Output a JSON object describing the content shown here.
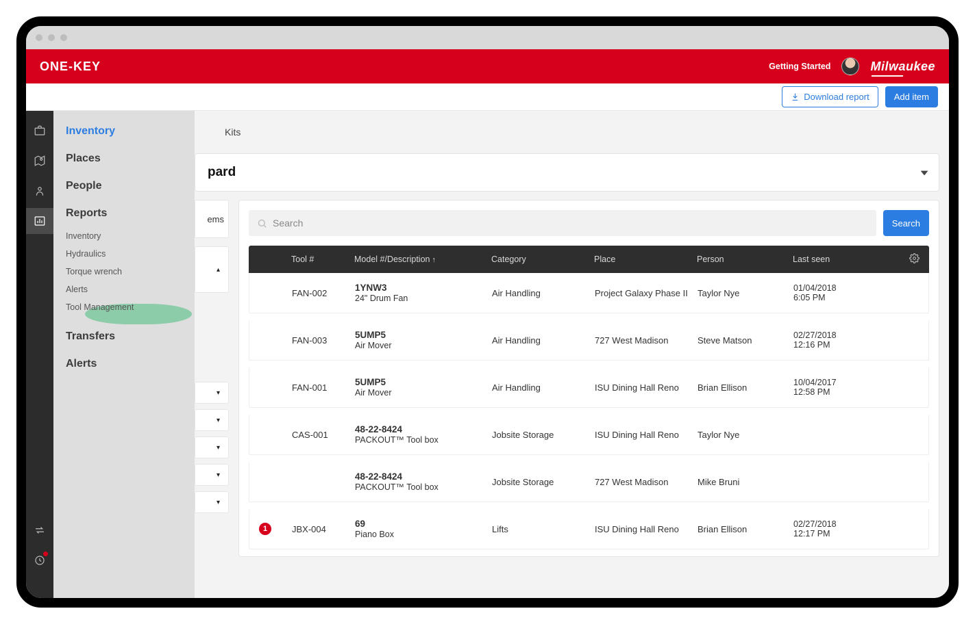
{
  "header": {
    "logo_left": "ONE-KEY",
    "getting_started": "Getting Started",
    "brand_right": "Milwaukee"
  },
  "actions": {
    "download_report": "Download report",
    "add_item": "Add item"
  },
  "rail": {
    "items": [
      "inventory",
      "places",
      "people",
      "reports",
      "transfers",
      "alerts"
    ]
  },
  "sidebar": {
    "inventory": "Inventory",
    "places": "Places",
    "people": "People",
    "reports": "Reports",
    "transfers": "Transfers",
    "alerts": "Alerts",
    "report_subs": {
      "inventory": "Inventory",
      "hydraulics": "Hydraulics",
      "torque": "Torque wrench",
      "alerts_sub": "Alerts",
      "tool_mgmt": "Tool Management"
    }
  },
  "tabs": {
    "kits": "Kits"
  },
  "board": {
    "title_fragment": "pard"
  },
  "left_fragments": {
    "ems": "ems"
  },
  "search": {
    "placeholder": "Search",
    "button": "Search"
  },
  "table": {
    "headers": {
      "tool": "Tool #",
      "model": "Model #/Description",
      "category": "Category",
      "place": "Place",
      "person": "Person",
      "last_seen": "Last seen"
    },
    "rows": [
      {
        "alert": "",
        "tool": "FAN-002",
        "model": "1YNW3",
        "desc": "24\" Drum Fan",
        "category": "Air Handling",
        "place": "Project Galaxy Phase II",
        "person": "Taylor Nye",
        "seen_date": "01/04/2018",
        "seen_time": "6:05 PM"
      },
      {
        "alert": "",
        "tool": "FAN-003",
        "model": "5UMP5",
        "desc": "Air Mover",
        "category": "Air Handling",
        "place": "727 West Madison",
        "person": "Steve Matson",
        "seen_date": "02/27/2018",
        "seen_time": "12:16 PM"
      },
      {
        "alert": "",
        "tool": "FAN-001",
        "model": "5UMP5",
        "desc": "Air Mover",
        "category": "Air Handling",
        "place": "ISU Dining Hall Reno",
        "person": "Brian Ellison",
        "seen_date": "10/04/2017",
        "seen_time": "12:58 PM"
      },
      {
        "alert": "",
        "tool": "CAS-001",
        "model": "48-22-8424",
        "desc": "PACKOUT™ Tool box",
        "category": "Jobsite Storage",
        "place": "ISU Dining Hall Reno",
        "person": "Taylor Nye",
        "seen_date": "",
        "seen_time": ""
      },
      {
        "alert": "",
        "tool": "",
        "model": "48-22-8424",
        "desc": "PACKOUT™ Tool box",
        "category": "Jobsite Storage",
        "place": "727 West Madison",
        "person": "Mike Bruni",
        "seen_date": "",
        "seen_time": ""
      },
      {
        "alert": "1",
        "tool": "JBX-004",
        "model": "69",
        "desc": "Piano Box",
        "category": "Lifts",
        "place": "ISU Dining Hall Reno",
        "person": "Brian Ellison",
        "seen_date": "02/27/2018",
        "seen_time": "12:17 PM"
      }
    ]
  }
}
